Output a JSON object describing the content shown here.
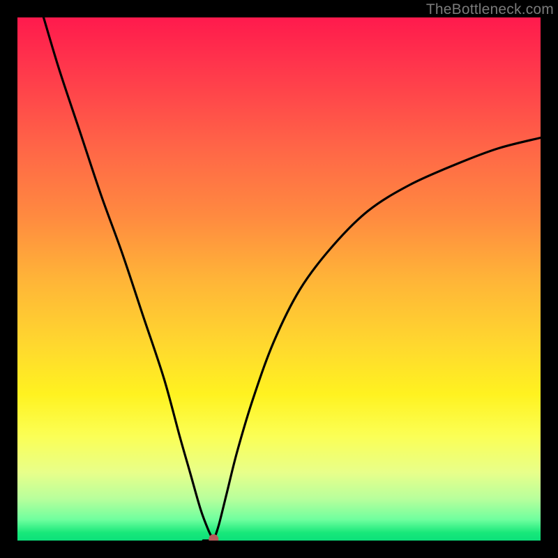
{
  "watermark": "TheBottleneck.com",
  "marker": {
    "x_pct": 37.5,
    "color": "#b75a5a",
    "radius": 7
  },
  "chart_data": {
    "type": "line",
    "title": "",
    "xlabel": "",
    "ylabel": "",
    "xlim": [
      0,
      100
    ],
    "ylim": [
      0,
      100
    ],
    "left_branch": {
      "x": [
        5,
        8,
        12,
        16,
        20,
        24,
        28,
        31,
        33,
        35,
        36.5,
        37.5
      ],
      "y": [
        100,
        90,
        78,
        66,
        55,
        43,
        31,
        20,
        13,
        6,
        2,
        0
      ]
    },
    "right_branch": {
      "x": [
        37.5,
        38.5,
        40,
        42,
        45,
        49,
        54,
        60,
        67,
        75,
        84,
        92,
        100
      ],
      "y": [
        0,
        3,
        9,
        17,
        27,
        38,
        48,
        56,
        63,
        68,
        72,
        75,
        77
      ]
    },
    "flat_bottom": {
      "x": [
        35.5,
        37.5
      ],
      "y": [
        0,
        0
      ]
    },
    "marker_point": {
      "x": 37.5,
      "y": 0
    }
  }
}
